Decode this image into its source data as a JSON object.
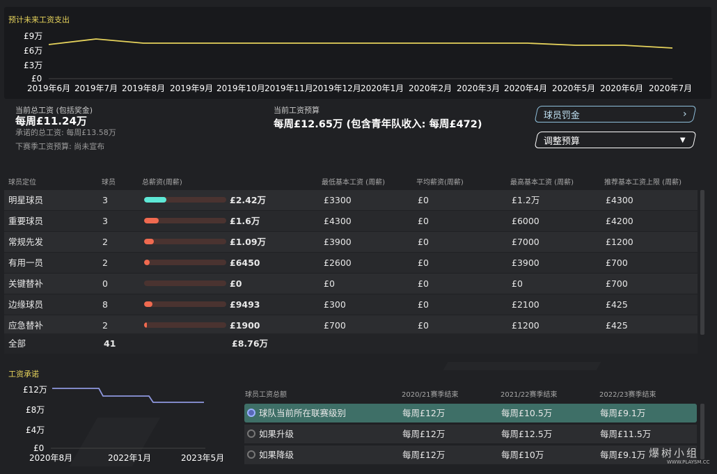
{
  "forecast": {
    "title": "预计未来工资支出",
    "y_ticks": [
      "£9万",
      "£6万",
      "£3万",
      "£0"
    ],
    "x_ticks": [
      "2019年6月",
      "2019年7月",
      "2019年8月",
      "2019年9月",
      "2019年10月",
      "2019年11月",
      "2019年12月",
      "2020年1月",
      "2020年2月",
      "2020年3月",
      "2020年4月",
      "2020年5月",
      "2020年6月",
      "2020年7月"
    ]
  },
  "summary": {
    "current_total_label": "当前总工资 (包括奖金)",
    "current_total_value": "每周£11.24万",
    "committed_label": "承诺的总工资: 每周£13.58万",
    "next_season_label": "下赛季工资预算: 尚未宣布",
    "budget_label": "当前工资预算",
    "budget_value": "每周£12.65万 (包含青年队收入: 每周£472)",
    "penalty_button": "球员罚金",
    "adjust_button": "调整预算"
  },
  "table": {
    "headers": [
      "球员定位",
      "球员",
      "总薪资(周薪)",
      "最低基本工资 (周薪)",
      "平均薪资(周薪)",
      "最高基本工资 (周薪)",
      "推荐基本工资上限 (周薪)"
    ],
    "rows": [
      {
        "role": "明星球员",
        "count": "3",
        "total": "£2.42万",
        "min": "£3300",
        "avg": "£0",
        "max": "£1.2万",
        "cap": "£4300"
      },
      {
        "role": "重要球员",
        "count": "3",
        "total": "£1.6万",
        "min": "£4300",
        "avg": "£0",
        "max": "£6000",
        "cap": "£4200"
      },
      {
        "role": "常规先发",
        "count": "2",
        "total": "£1.09万",
        "min": "£3900",
        "avg": "£0",
        "max": "£7000",
        "cap": "£1200"
      },
      {
        "role": "有用一员",
        "count": "2",
        "total": "£6450",
        "min": "£2600",
        "avg": "£0",
        "max": "£3900",
        "cap": "£700"
      },
      {
        "role": "关键替补",
        "count": "0",
        "total": "£0",
        "min": "£0",
        "avg": "£0",
        "max": "£0",
        "cap": "£700"
      },
      {
        "role": "边缘球员",
        "count": "8",
        "total": "£9493",
        "min": "£300",
        "avg": "£0",
        "max": "£2100",
        "cap": "£425"
      },
      {
        "role": "应急替补",
        "count": "2",
        "total": "£1900",
        "min": "£700",
        "avg": "£0",
        "max": "£1200",
        "cap": "£425"
      }
    ],
    "total_row": {
      "label": "全部",
      "count": "41",
      "total": "£8.76万"
    }
  },
  "commitments": {
    "title": "工资承诺",
    "y_ticks": [
      "£12万",
      "£8万",
      "£4万",
      "£0"
    ],
    "x_ticks": [
      "2020年8月",
      "2022年1月",
      "2023年5月"
    ],
    "headers": [
      "球员工资总额",
      "2020/21赛季结束",
      "2021/22赛季结束",
      "2022/23赛季结束"
    ],
    "rows": [
      {
        "label": "球队当前所在联赛级别",
        "v1": "每周£12万",
        "v2": "每周£10.5万",
        "v3": "每周£9.1万",
        "selected": true
      },
      {
        "label": "如果升级",
        "v1": "每周£12万",
        "v2": "每周£12.5万",
        "v3": "每周£11.5万",
        "selected": false
      },
      {
        "label": "如果降级",
        "v1": "每周£12万",
        "v2": "每周£10万",
        "v3": "每周£9.1万",
        "selected": false
      }
    ]
  },
  "watermark": {
    "name": "爆树小组",
    "url": "WWW.PLAYSM.CC"
  },
  "colors": {
    "accent_yellow": "#e6d35c",
    "line_blue": "#8f98e0",
    "bar_cyan": "#5ee8d6",
    "bar_red": "#f06a50",
    "highlight_row": "#3e6f67"
  }
}
